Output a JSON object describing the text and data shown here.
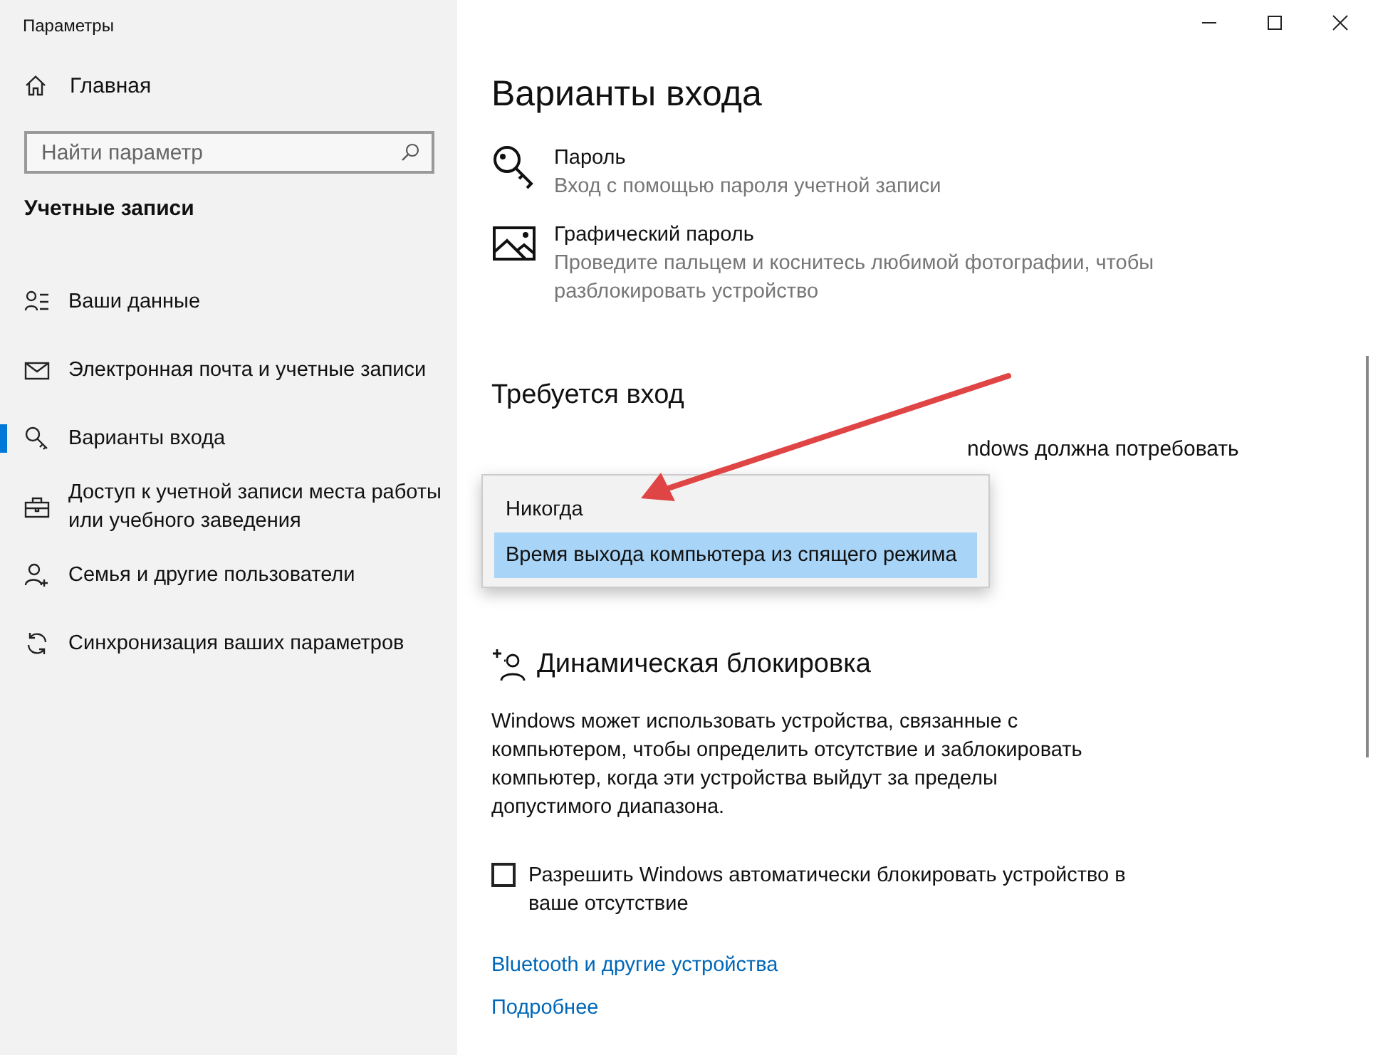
{
  "window": {
    "title": "Параметры",
    "controls": [
      {
        "kind": "minimize"
      },
      {
        "kind": "maximize"
      },
      {
        "kind": "close"
      }
    ]
  },
  "sidebar": {
    "home": "Главная",
    "search": {
      "placeholder": "Найти параметр"
    },
    "section": "Учетные записи",
    "items": [
      {
        "label": "Ваши данные",
        "kind": "person-list",
        "selected": false
      },
      {
        "label": "Электронная почта и учетные записи",
        "kind": "mail",
        "selected": false
      },
      {
        "label": "Варианты входа",
        "kind": "key",
        "selected": true
      },
      {
        "label": "Доступ к учетной записи места работы или учебного заведения",
        "kind": "briefcase",
        "selected": false
      },
      {
        "label": "Семья и другие пользователи",
        "kind": "person-add",
        "selected": false
      },
      {
        "label": "Синхронизация ваших параметров",
        "kind": "sync",
        "selected": false
      }
    ]
  },
  "page": {
    "title": "Варианты входа",
    "options": [
      {
        "kind": "key",
        "title": "Пароль",
        "description": "Вход с помощью пароля учетной записи"
      },
      {
        "kind": "picture",
        "title": "Графический пароль",
        "description": "Проведите пальцем и коснитесь любимой фотографии, чтобы разблокировать устройство"
      }
    ],
    "require_signin": {
      "heading": "Требуется вход",
      "partial_text": "ndows должна потребовать",
      "dropdown": [
        {
          "label": "Никогда",
          "selected": false
        },
        {
          "label": "Время выхода компьютера из спящего режима",
          "selected": true
        }
      ]
    },
    "dynamic_lock": {
      "heading": "Динамическая блокировка",
      "description": "Windows может использовать устройства, связанные с компьютером, чтобы определить отсутствие и заблокировать компьютер, когда эти устройства выйдут за пределы допустимого диапазона.",
      "checkbox": {
        "label": "Разрешить Windows автоматически блокировать устройство в ваше отсутствие",
        "checked": false
      },
      "links": [
        "Bluetooth и другие устройства",
        "Подробнее"
      ]
    }
  }
}
